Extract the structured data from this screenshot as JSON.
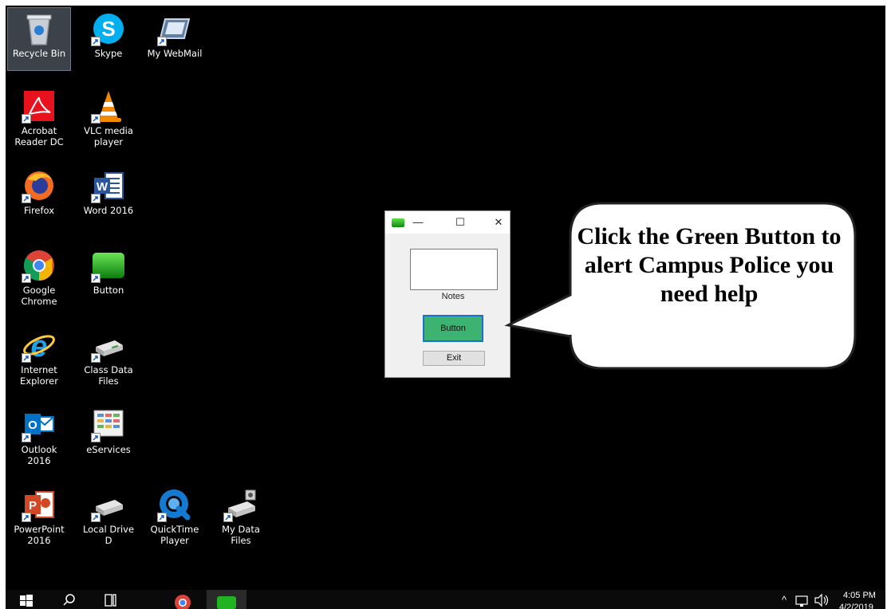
{
  "desktop": {
    "icons": [
      {
        "label": "Recycle Bin",
        "icon": "recycle-bin-icon"
      },
      {
        "label": "Skype",
        "icon": "skype-icon"
      },
      {
        "label": "My WebMail",
        "icon": "webmail-icon"
      },
      {
        "label": "Acrobat Reader DC",
        "icon": "acrobat-icon"
      },
      {
        "label": "VLC media player",
        "icon": "vlc-icon"
      },
      {
        "label": "Firefox",
        "icon": "firefox-icon"
      },
      {
        "label": "Word 2016",
        "icon": "word-icon"
      },
      {
        "label": "Google Chrome",
        "icon": "chrome-icon"
      },
      {
        "label": "Button",
        "icon": "green-button-app-icon"
      },
      {
        "label": "Internet Explorer",
        "icon": "internet-explorer-icon"
      },
      {
        "label": "Class Data Files",
        "icon": "network-drive-icon"
      },
      {
        "label": "Outlook 2016",
        "icon": "outlook-icon"
      },
      {
        "label": "eServices",
        "icon": "eservices-icon"
      },
      {
        "label": "PowerPoint 2016",
        "icon": "powerpoint-icon"
      },
      {
        "label": "Local Drive D",
        "icon": "drive-icon"
      },
      {
        "label": "QuickTime Player",
        "icon": "quicktime-icon"
      },
      {
        "label": "My Data Files",
        "icon": "network-drive-icon"
      }
    ]
  },
  "app_window": {
    "minimize": "—",
    "maximize": "☐",
    "close": "✕",
    "notes_label": "Notes",
    "button_label": "Button",
    "exit_label": "Exit"
  },
  "callout": {
    "text": "Click the Green Button to alert Campus Police you need help"
  },
  "taskbar": {
    "time": "4:05 PM",
    "date": "4/2/2019",
    "tray_chevron": "^",
    "pinned": [
      "start-icon",
      "search-icon",
      "task-view-icon",
      "chrome-icon",
      "green-button-app-icon"
    ]
  },
  "colors": {
    "desktop_bg": "#000000",
    "app_button": "#3cb371",
    "taskbar": "#0a0a0a"
  }
}
